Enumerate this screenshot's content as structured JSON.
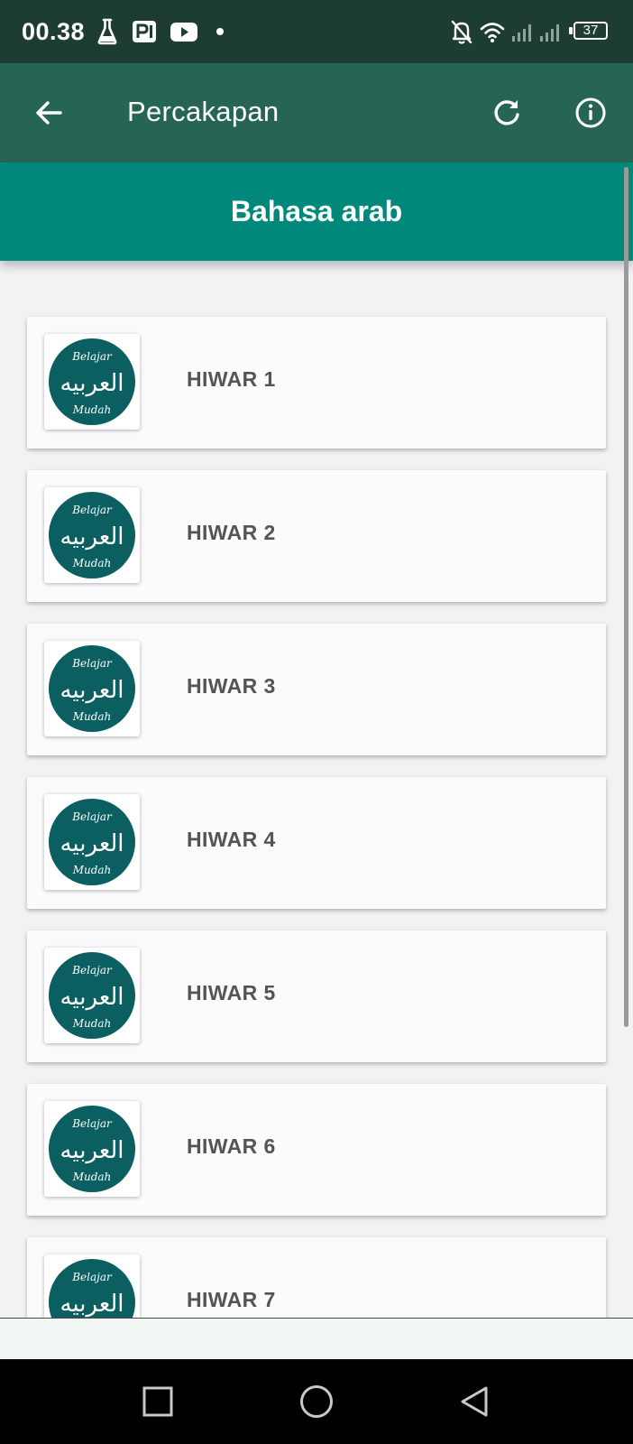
{
  "status_bar": {
    "time": "00.38",
    "battery": "37",
    "icons": [
      "flask-icon",
      "parking-app-icon",
      "youtube-icon",
      "notification-dot-icon",
      "bell-off-icon",
      "wifi-icon",
      "signal-icon"
    ]
  },
  "app_bar": {
    "title": "Percakapan",
    "back_icon": "arrow-left-icon",
    "refresh_icon": "refresh-icon",
    "info_icon": "info-icon"
  },
  "banner": {
    "title": "Bahasa arab"
  },
  "logo": {
    "top_text": "Belajar",
    "arabic_text": "العربيه",
    "bottom_text": "Mudah",
    "color": "#0b5f60"
  },
  "list": {
    "items": [
      {
        "label": "HIWAR 1"
      },
      {
        "label": "HIWAR 2"
      },
      {
        "label": "HIWAR 3"
      },
      {
        "label": "HIWAR 4"
      },
      {
        "label": "HIWAR 5"
      },
      {
        "label": "HIWAR 6"
      },
      {
        "label": "HIWAR 7"
      }
    ]
  },
  "nav_bar": {
    "recents_icon": "square-icon",
    "home_icon": "circle-icon",
    "back_icon": "triangle-back-icon"
  },
  "colors": {
    "status_bar": "#1e3d32",
    "app_bar": "#266453",
    "banner": "#00897b",
    "card": "#fbfafc",
    "label": "#545454"
  }
}
